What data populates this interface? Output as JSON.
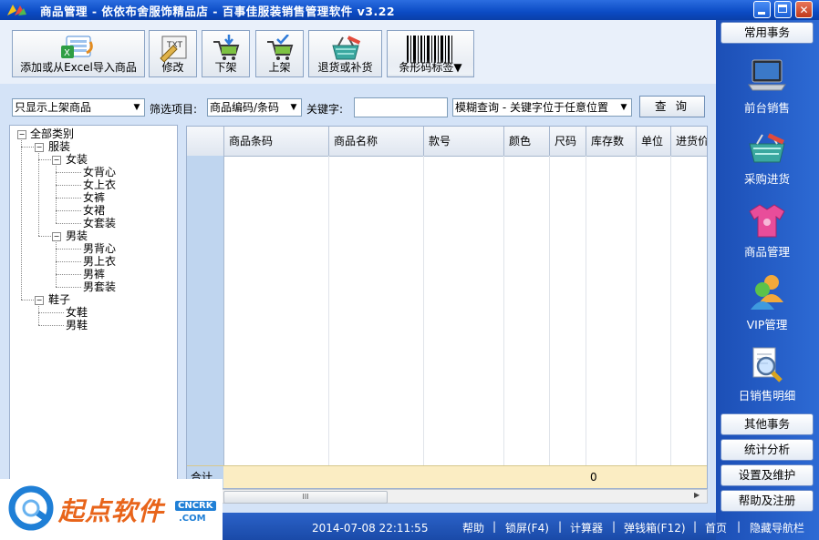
{
  "window": {
    "title": "商品管理 - 依依布舍服饰精品店 - 百事佳服装销售管理软件 v3.22",
    "min_icon": "minimize-icon",
    "max_icon": "maximize-icon",
    "close_icon": "close-icon"
  },
  "toolbar": {
    "import_label": "添加或从Excel导入商品",
    "edit_label": "修改",
    "unlist_label": "下架",
    "list_label": "上架",
    "return_label": "退货或补货",
    "barcode_label": "条形码标签▼"
  },
  "filter": {
    "status_select": "只显示上架商品",
    "filter_label": "筛选项目:",
    "field_select": "商品编码/条码",
    "keyword_label": "关键字:",
    "keyword_value": "",
    "mode_select": "模糊查询 - 关键字位于任意位置",
    "search_label": "查 询"
  },
  "tree": {
    "root": "全部类别",
    "clothing": "服装",
    "women": "女装",
    "women_items": [
      "女背心",
      "女上衣",
      "女裤",
      "女裙",
      "女套装"
    ],
    "men": "男装",
    "men_items": [
      "男背心",
      "男上衣",
      "男裤",
      "男套装"
    ],
    "shoes": "鞋子",
    "shoe_items": [
      "女鞋",
      "男鞋"
    ]
  },
  "grid": {
    "columns": [
      "商品条码",
      "商品名称",
      "款号",
      "颜色",
      "尺码",
      "库存数",
      "单位",
      "进货价"
    ],
    "total_label": "合计",
    "total_stock": "0",
    "scroll_grip": "III"
  },
  "sidebar": {
    "common_tasks": "常用事务",
    "items": [
      {
        "label": "前台销售",
        "icon": "laptop-icon"
      },
      {
        "label": "采购进货",
        "icon": "basket-icon"
      },
      {
        "label": "商品管理",
        "icon": "shirt-icon"
      },
      {
        "label": "VIP管理",
        "icon": "users-icon"
      },
      {
        "label": "日销售明细",
        "icon": "magnifier-icon"
      }
    ],
    "other_tasks": "其他事务",
    "stats": "统计分析",
    "settings": "设置及维护",
    "help_register": "帮助及注册"
  },
  "statusbar": {
    "datetime": "2014-07-08 22:11:55",
    "help": "帮助",
    "lock": "锁屏(F4)",
    "calculator": "计算器",
    "cash_drawer": "弹钱箱(F12)",
    "home": "首页",
    "hide_nav": "隐藏导航栏",
    "separator": "|"
  },
  "watermark": {
    "brand": "起点软件",
    "badge": "CNCRK",
    "domain": ".COM"
  },
  "colors": {
    "titlebar": "#0b4bc4",
    "sidebar": "#1c4fb6",
    "total_row": "#fbedc3",
    "row_indicator": "#bfd5ef"
  }
}
